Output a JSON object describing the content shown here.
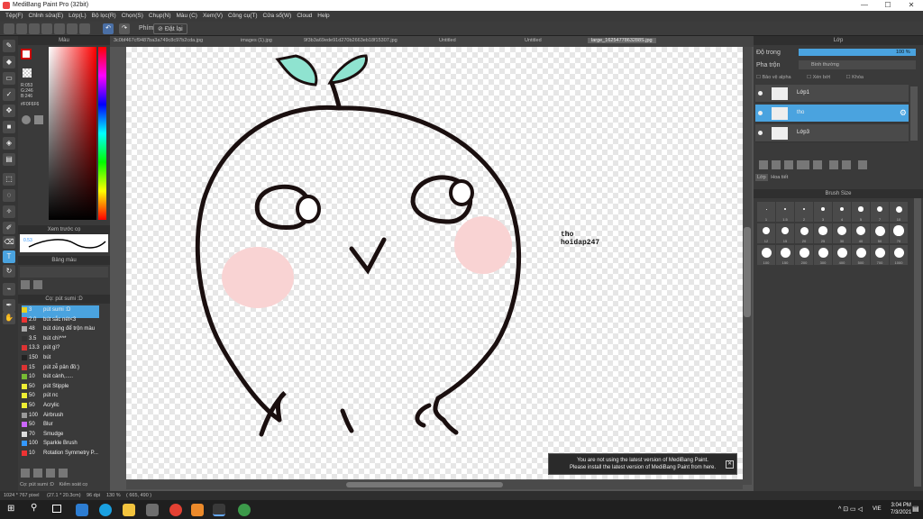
{
  "window": {
    "title": "MediBang Paint Pro (32bit)",
    "minimize": "—",
    "maximize": "☐",
    "close": "✕"
  },
  "menu": [
    "Tệp(F)",
    "Chỉnh sửa(E)",
    "Lớp(L)",
    "Bộ lọc(R)",
    "Chọn(S)",
    "Chụp(N)",
    "Màu (C)",
    "Xem(V)",
    "Công cụ(T)",
    "Cửa sổ(W)",
    "Cloud",
    "Help"
  ],
  "toolbar": {
    "mode_label": "Phím",
    "mode_value": "Đặt lại"
  },
  "tabs": [
    "3c0bf467cf9487ba3a749c8c97b2cda.jpg",
    "images (1).jpg",
    "9f3b3a69ede91d270b2663eb18f15307.jpg",
    "Untitled",
    "Untitled",
    "large_1625477863288S.jpg"
  ],
  "color_panel": {
    "title": "Màu",
    "r": "R:053",
    "g": "G:246",
    "b": "B:246",
    "hex": "#F0F6F6"
  },
  "preview": {
    "title": "Xem trước cọ",
    "size": "0.53"
  },
  "palette": {
    "title": "Bảng màu"
  },
  "brush_panel": {
    "title": "Cọ: pút sumi :D",
    "items": [
      {
        "color": "#e8d020",
        "size": "3",
        "name": "pút sumi :D",
        "selected": true
      },
      {
        "color": "#e33",
        "size": "2.0",
        "name": "bút sắc nét<3"
      },
      {
        "color": "#aaa",
        "size": "48",
        "name": "bút dùng để trộn màu"
      },
      {
        "color": "#333",
        "size": "3.5",
        "name": "bút chì*^*"
      },
      {
        "color": "#d33",
        "size": "13.3",
        "name": "pút gì?"
      },
      {
        "color": "#222",
        "size": "150",
        "name": "bút"
      },
      {
        "color": "#d33",
        "size": "15",
        "name": "pút zễ pản đồ:)"
      },
      {
        "color": "#7b3",
        "size": "10",
        "name": "bút cánh,....."
      },
      {
        "color": "#ee3",
        "size": "50",
        "name": "pút Stipple"
      },
      {
        "color": "#ee3",
        "size": "50",
        "name": "pút nc"
      },
      {
        "color": "#ee3",
        "size": "50",
        "name": "Acrylic"
      },
      {
        "color": "#999",
        "size": "100",
        "name": "Airbrush"
      },
      {
        "color": "#c6f",
        "size": "50",
        "name": "Blur"
      },
      {
        "color": "#ddd",
        "size": "70",
        "name": "Smudge"
      },
      {
        "color": "#39f",
        "size": "100",
        "name": "Sparkle Brush"
      },
      {
        "color": "#e33",
        "size": "10",
        "name": "Rotation Symmetry P..."
      }
    ],
    "footer_tabs": [
      "Cọ: pút sumi :D",
      "Kiểm soát cọ"
    ]
  },
  "layer_panel": {
    "title": "Lớp",
    "opacity_label": "Độ trong",
    "opacity_value": "100 %",
    "blend_label": "Pha trộn",
    "blend_value": "Bình thường",
    "protect_alpha": "Bảo vệ alpha",
    "clipping": "Xén bớt",
    "lock": "Khóa",
    "layers": [
      {
        "name": "Lớp1",
        "selected": false
      },
      {
        "name": "tho",
        "selected": true
      },
      {
        "name": "Lớp3",
        "selected": false
      }
    ],
    "tabs": [
      "Lớp",
      "Hoa tiết"
    ]
  },
  "brush_size": {
    "title": "Brush Size",
    "row1": [
      "1",
      "1.5",
      "2",
      "3",
      "4",
      "5",
      "7",
      "10"
    ],
    "row2": [
      "12",
      "15",
      "20",
      "25",
      "30",
      "40",
      "50",
      "70"
    ],
    "row3": [
      "100",
      "150",
      "200",
      "300",
      "400",
      "500",
      "700",
      "1000"
    ]
  },
  "canvas_text": {
    "line1": "tho",
    "line2": "hoidap247"
  },
  "notice": {
    "line1": "You are not using the latest version of MediBang Paint.",
    "line2": "Please install the latest version of MediBang Paint from here."
  },
  "status": {
    "dimensions": "1024 * 767 pixel",
    "size_cm": "(27.1 * 20.3cm)",
    "dpi": "96 dpi",
    "zoom": "130 %",
    "coords": "( 665, 490 )"
  },
  "taskbar": {
    "time": "3:04 PM",
    "date": "7/3/2021",
    "lang": "VIE"
  }
}
